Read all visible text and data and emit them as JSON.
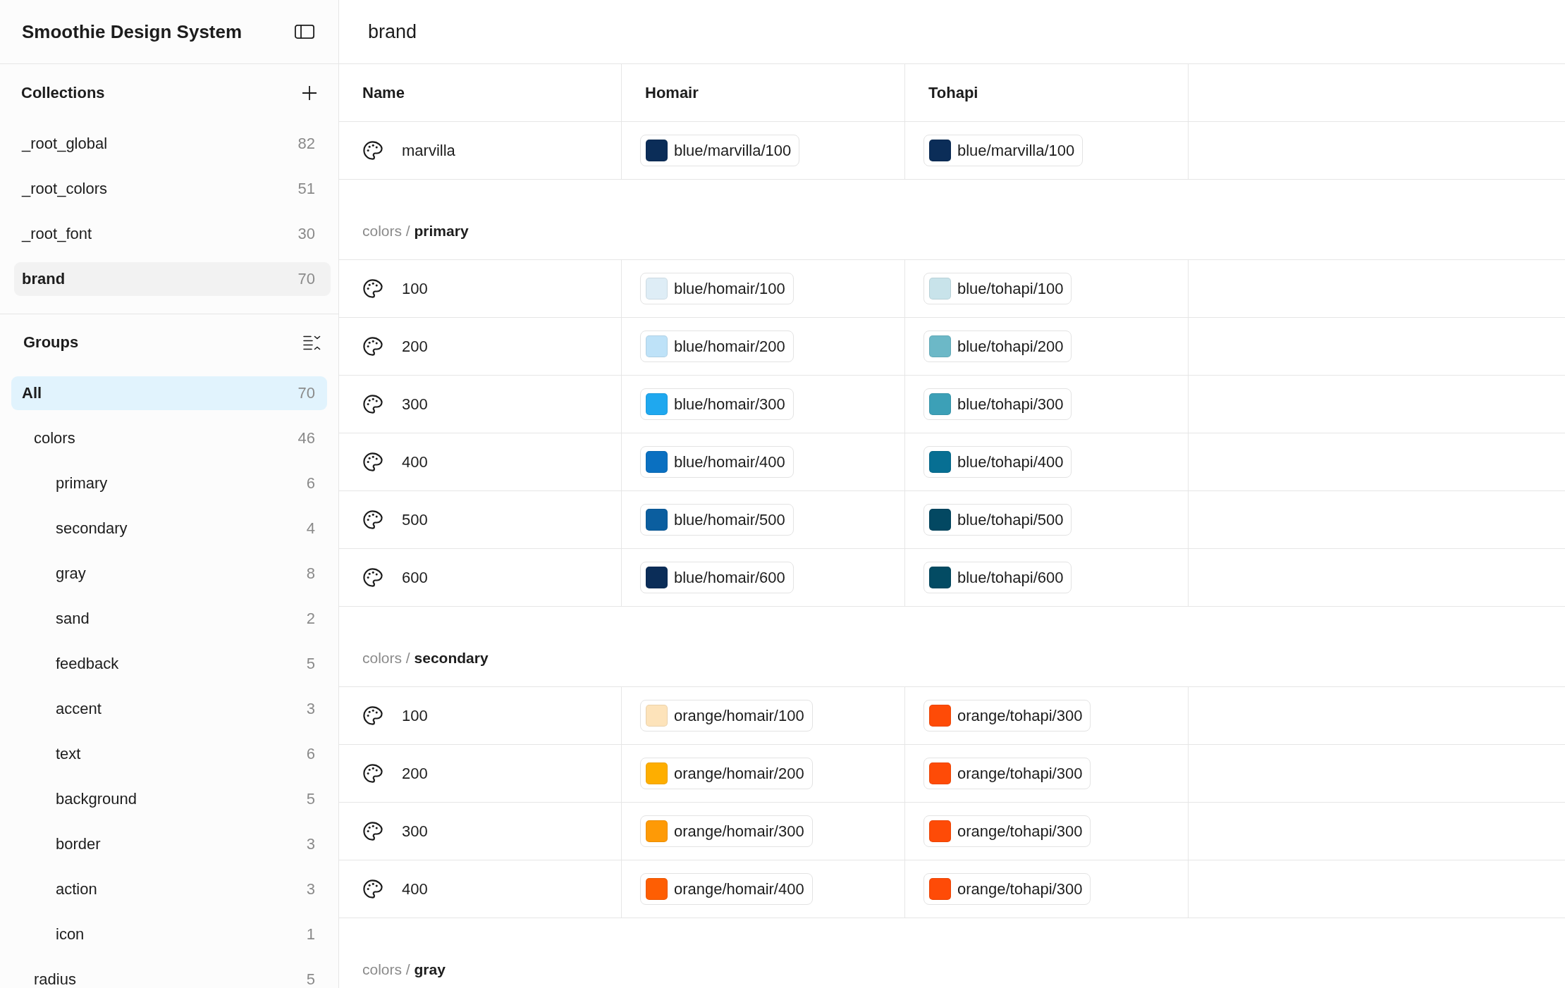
{
  "sidebar": {
    "title": "Smoothie Design System",
    "collections": {
      "title": "Collections",
      "items": [
        {
          "label": "_root_global",
          "count": "82",
          "selected": false
        },
        {
          "label": "_root_colors",
          "count": "51",
          "selected": false
        },
        {
          "label": "_root_font",
          "count": "30",
          "selected": false
        },
        {
          "label": "brand",
          "count": "70",
          "selected": true
        }
      ]
    },
    "groups": {
      "title": "Groups",
      "items": [
        {
          "label": "All",
          "count": "70",
          "selected": true,
          "children": [
            {
              "label": "colors",
              "count": "46",
              "selected": false,
              "children": [
                {
                  "label": "primary",
                  "count": "6",
                  "selected": false
                },
                {
                  "label": "secondary",
                  "count": "4",
                  "selected": false
                },
                {
                  "label": "gray",
                  "count": "8",
                  "selected": false
                },
                {
                  "label": "sand",
                  "count": "2",
                  "selected": false
                },
                {
                  "label": "feedback",
                  "count": "5",
                  "selected": false
                },
                {
                  "label": "accent",
                  "count": "3",
                  "selected": false
                },
                {
                  "label": "text",
                  "count": "6",
                  "selected": false
                },
                {
                  "label": "background",
                  "count": "5",
                  "selected": false
                },
                {
                  "label": "border",
                  "count": "3",
                  "selected": false
                },
                {
                  "label": "action",
                  "count": "3",
                  "selected": false
                },
                {
                  "label": "icon",
                  "count": "1",
                  "selected": false
                }
              ]
            },
            {
              "label": "radius",
              "count": "5",
              "selected": false
            }
          ]
        }
      ]
    }
  },
  "main": {
    "title": "brand",
    "table": {
      "columns": [
        "Name",
        "Homair",
        "Tohapi"
      ],
      "sections": [
        {
          "rows": [
            {
              "name": "marvilla",
              "values": [
                {
                  "label": "blue/marvilla/100",
                  "color": "#0b2d58"
                },
                {
                  "label": "blue/marvilla/100",
                  "color": "#0b2d58"
                }
              ]
            }
          ]
        },
        {
          "heading": "colors / **primary**",
          "rows": [
            {
              "name": "100",
              "values": [
                {
                  "label": "blue/homair/100",
                  "color": "#deedf6"
                },
                {
                  "label": "blue/tohapi/100",
                  "color": "#c8e3ea"
                }
              ]
            },
            {
              "name": "200",
              "values": [
                {
                  "label": "blue/homair/200",
                  "color": "#bee2f8"
                },
                {
                  "label": "blue/tohapi/200",
                  "color": "#6cb8c7"
                }
              ]
            },
            {
              "name": "300",
              "values": [
                {
                  "label": "blue/homair/300",
                  "color": "#1fa8ef"
                },
                {
                  "label": "blue/tohapi/300",
                  "color": "#3ca0b7"
                }
              ]
            },
            {
              "name": "400",
              "values": [
                {
                  "label": "blue/homair/400",
                  "color": "#0a70c1"
                },
                {
                  "label": "blue/tohapi/400",
                  "color": "#076f93"
                }
              ]
            },
            {
              "name": "500",
              "values": [
                {
                  "label": "blue/homair/500",
                  "color": "#0b5e9f"
                },
                {
                  "label": "blue/tohapi/500",
                  "color": "#034862"
                }
              ]
            },
            {
              "name": "600",
              "values": [
                {
                  "label": "blue/homair/600",
                  "color": "#0b2d58"
                },
                {
                  "label": "blue/tohapi/600",
                  "color": "#034b63"
                }
              ]
            }
          ]
        },
        {
          "heading": "colors / **secondary**",
          "rows": [
            {
              "name": "100",
              "values": [
                {
                  "label": "orange/homair/100",
                  "color": "#fde3ba"
                },
                {
                  "label": "orange/tohapi/300",
                  "color": "#fe4b07"
                }
              ]
            },
            {
              "name": "200",
              "values": [
                {
                  "label": "orange/homair/200",
                  "color": "#feae00"
                },
                {
                  "label": "orange/tohapi/300",
                  "color": "#fe4b07"
                }
              ]
            },
            {
              "name": "300",
              "values": [
                {
                  "label": "orange/homair/300",
                  "color": "#fe9a06"
                },
                {
                  "label": "orange/tohapi/300",
                  "color": "#fe4b07"
                }
              ]
            },
            {
              "name": "400",
              "values": [
                {
                  "label": "orange/homair/400",
                  "color": "#fe5e03"
                },
                {
                  "label": "orange/tohapi/300",
                  "color": "#fe4b07"
                }
              ]
            }
          ]
        },
        {
          "heading": "colors / **gray**"
        }
      ]
    }
  }
}
